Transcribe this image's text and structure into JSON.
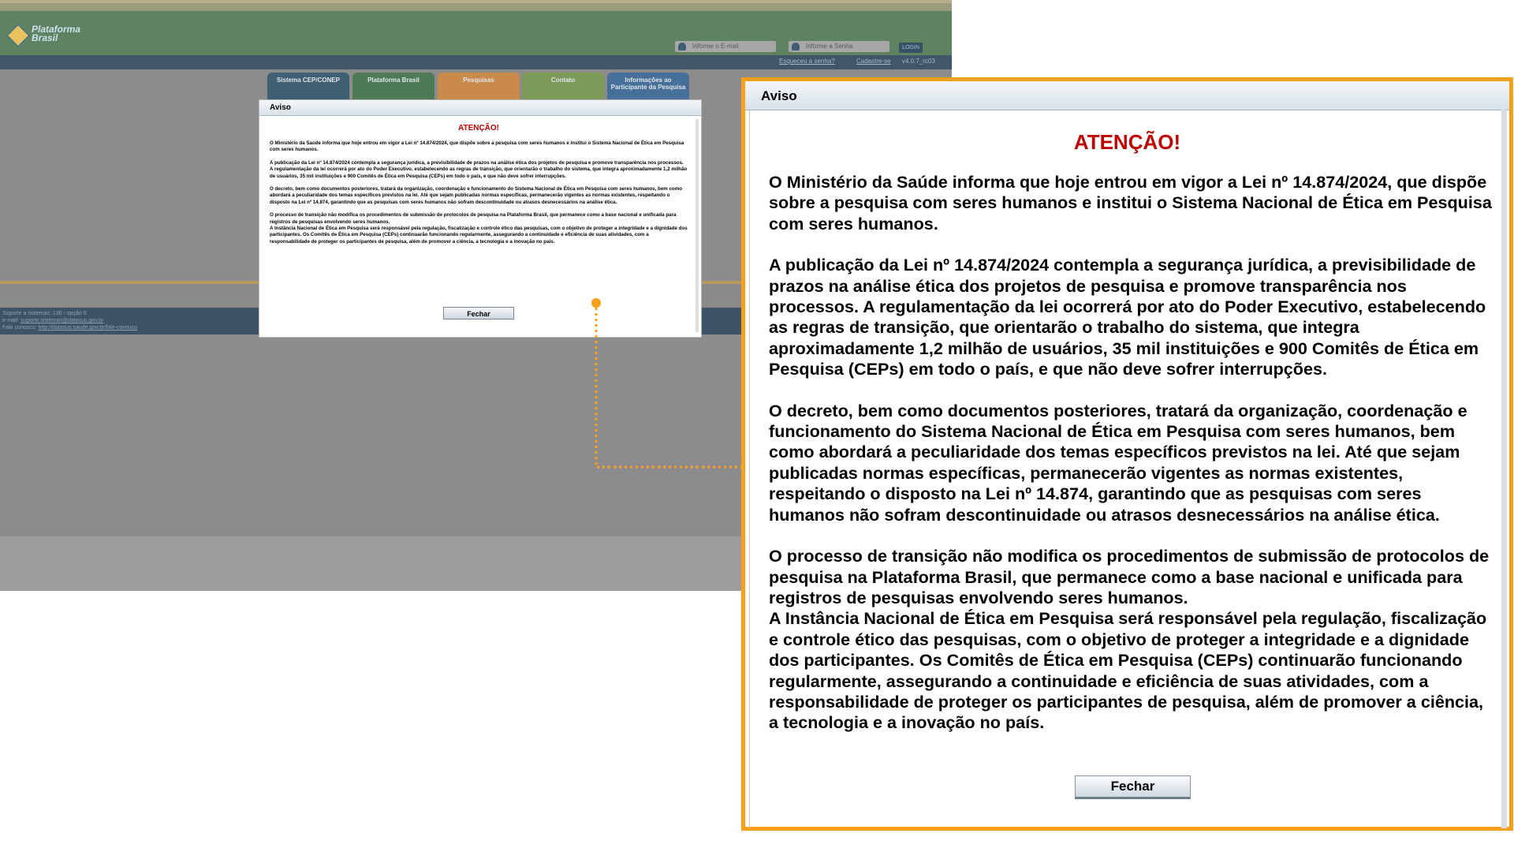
{
  "background": {
    "logo_text": "Plataforma Brasil",
    "login": {
      "email_placeholder": "Informe o E-mail",
      "password_placeholder": "Informe a Senha",
      "login_button": "LOGIN"
    },
    "links": {
      "forgot_password": "Esqueceu a senha?",
      "register": "Cadastre-se",
      "version": "v4.0.7_rc03"
    },
    "nav_tabs": [
      {
        "label": "Sistema CEP/CONEP",
        "color": "#3f5f73"
      },
      {
        "label": "Plataforma Brasil",
        "color": "#4f7a58"
      },
      {
        "label": "Pesquisas",
        "color": "#c98a4a"
      },
      {
        "label": "Contato",
        "color": "#7d9a58"
      },
      {
        "label": "Informações ao Participante da Pesquisa",
        "color": "#46709a"
      }
    ],
    "footer": {
      "support": "Suporte a sistemas: 136 - opção 8",
      "email_label": "e-mail:",
      "email": "suporte.sistemas@datasus.gov.br",
      "contact_label": "Fale conosco:",
      "contact_url": "http://datasus.saude.gov.br/fale-conosco"
    }
  },
  "modal": {
    "header": "Aviso",
    "title": "ATENÇÃO!",
    "paragraphs": [
      "O Ministério da Saúde informa que hoje entrou em vigor a Lei nº 14.874/2024, que dispõe sobre a pesquisa com seres humanos e institui o Sistema Nacional de Ética em Pesquisa com seres humanos.",
      "A publicação da Lei nº 14.874/2024 contempla a segurança jurídica, a previsibilidade de prazos na análise ética dos projetos de pesquisa e promove transparência nos processos. A regulamentação da lei ocorrerá por ato do Poder Executivo, estabelecendo as regras de transição, que orientarão o trabalho do sistema, que integra aproximadamente 1,2 milhão de usuários, 35 mil instituições e 900 Comitês de Ética em Pesquisa (CEPs) em todo o país, e que não deve sofrer interrupções.",
      "O decreto, bem como documentos posteriores, tratará da organização, coordenação e funcionamento do Sistema Nacional de Ética em Pesquisa com seres humanos, bem como abordará a peculiaridade dos temas específicos previstos na lei. Até que sejam publicadas normas específicas, permanecerão vigentes as normas existentes, respeitando o disposto na Lei nº 14.874, garantindo que as pesquisas com seres humanos não sofram descontinuidade ou atrasos desnecessários na análise ética.",
      "O processo de transição não modifica os procedimentos de submissão de protocolos de pesquisa na Plataforma Brasil, que permanece como a base nacional e unificada para registros de pesquisas envolvendo seres humanos.\nA Instância Nacional de Ética em Pesquisa será responsável pela regulação, fiscalização e controle ético das pesquisas, com o objetivo de proteger a integridade e a dignidade dos participantes. Os Comitês de Ética em Pesquisa (CEPs) continuarão funcionando regularmente, assegurando a continuidade e eficiência de suas atividades, com a responsabilidade de proteger os participantes de pesquisa, além de promover a ciência, a tecnologia e a inovação no país."
    ],
    "close_button": "Fechar"
  },
  "colors": {
    "highlight": "#f7a11a",
    "title_red": "#c00000"
  }
}
